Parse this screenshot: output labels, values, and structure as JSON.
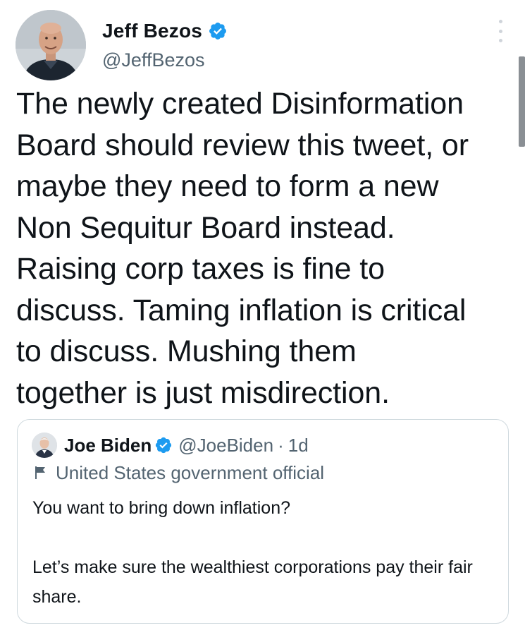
{
  "author": {
    "name": "Jeff Bezos",
    "handle": "@JeffBezos",
    "verified": true
  },
  "tweet": {
    "text": "The newly created Disinformation\nBoard should review this tweet, or\nmaybe they need to form a new\nNon Sequitur Board instead.\nRaising corp taxes is fine to\ndiscuss. Taming inflation is critical\nto discuss. Mushing them\ntogether is just misdirection."
  },
  "quote": {
    "name": "Joe Biden",
    "handle": "@JoeBiden",
    "separator": "·",
    "time": "1d",
    "verified": true,
    "label": "United States government official",
    "paragraphs": [
      "You want to bring down inflation?",
      "Let’s make sure the wealthiest corporations pay their fair share."
    ]
  },
  "colors": {
    "verified_blue": "#1d9bf0",
    "secondary_text": "#536471",
    "primary_text": "#0f1419",
    "border": "#cfd9de"
  },
  "icons": {
    "more": "more-vertical-icon",
    "verified": "verified-badge-icon",
    "label": "flag-icon"
  }
}
